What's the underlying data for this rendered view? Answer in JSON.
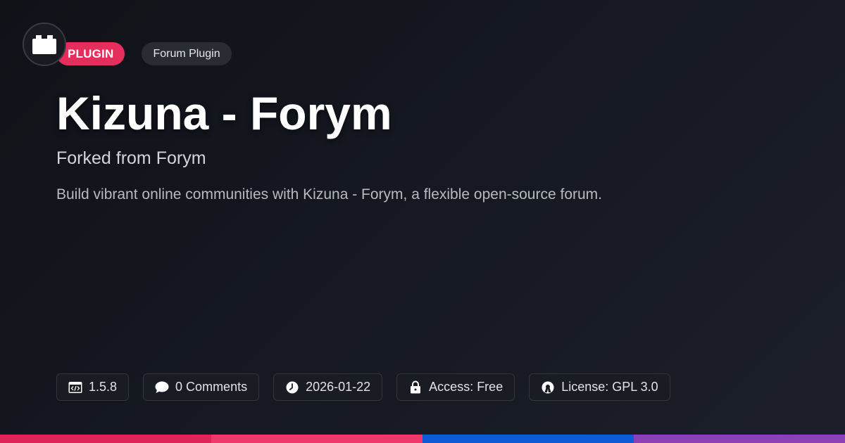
{
  "header": {
    "logo_icon": "plugin-block-icon",
    "type_badge": "PLUGIN",
    "category_badge": "Forum Plugin"
  },
  "main": {
    "title": "Kizuna - Forym",
    "subtitle": "Forked from Forym",
    "description": "Build vibrant online communities with Kizuna - Forym, a flexible open-source forum."
  },
  "meta": {
    "version": {
      "icon": "code-window-icon",
      "label": "1.5.8"
    },
    "comments": {
      "icon": "comment-bubble-icon",
      "label": "0 Comments"
    },
    "date": {
      "icon": "clock-icon",
      "label": "2026-01-22"
    },
    "access": {
      "icon": "lock-icon",
      "label": "Access: Free"
    },
    "license": {
      "icon": "open-source-icon",
      "label": "License: GPL 3.0"
    }
  },
  "colors": {
    "background": "#151821",
    "accent_pink": "#e62e5c",
    "bar": [
      "#e0245a",
      "#f0386b",
      "#0f5bd6",
      "#8e3fb5"
    ]
  }
}
